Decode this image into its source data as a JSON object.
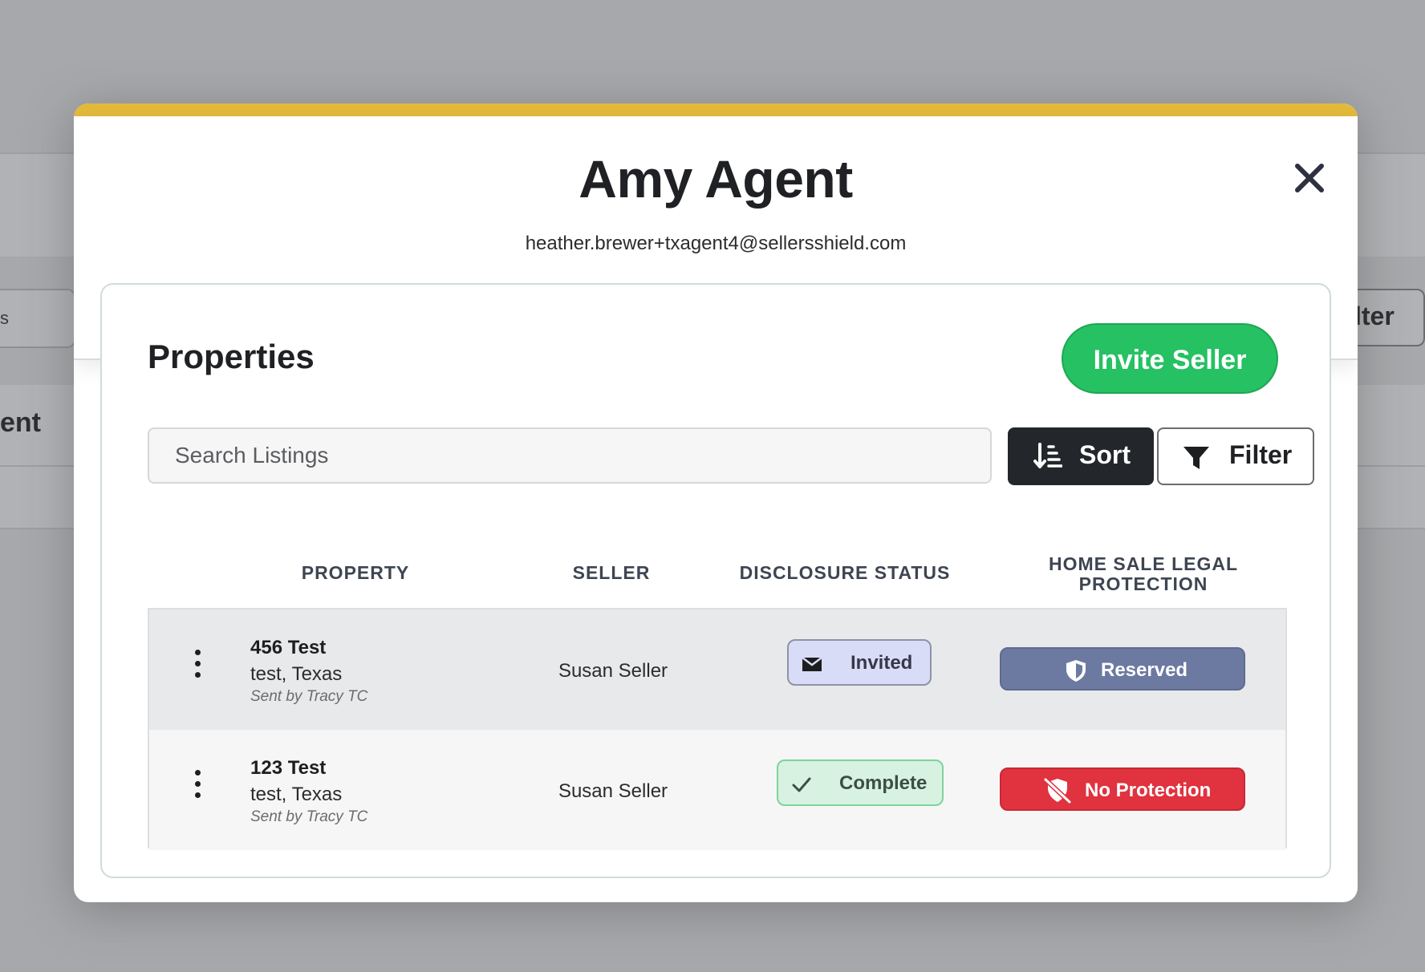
{
  "background": {
    "left_field_fragment": "s",
    "left_text_fragment": "ent",
    "right_button_fragment": "lter"
  },
  "modal": {
    "title": "Amy Agent",
    "email": "heather.brewer+txagent4@sellersshield.com",
    "accent_color": "#e2b93b"
  },
  "properties": {
    "heading": "Properties",
    "invite_button": "Invite Seller",
    "search_placeholder": "Search Listings",
    "sort_label": "Sort",
    "filter_label": "Filter"
  },
  "table": {
    "headers": {
      "property": "PROPERTY",
      "seller": "SELLER",
      "disclosure_status": "DISCLOSURE STATUS",
      "protection_line1": "HOME SALE LEGAL",
      "protection_line2": "PROTECTION"
    },
    "rows": [
      {
        "address": "456 Test",
        "city": "test, Texas",
        "sent_by": "Sent by Tracy TC",
        "seller": "Susan Seller",
        "disclosure_status": "Invited",
        "disclosure_icon": "envelope-icon",
        "protection": "Reserved",
        "protection_icon": "shield-icon",
        "protection_color": "#6c7aa2"
      },
      {
        "address": "123 Test",
        "city": "test, Texas",
        "sent_by": "Sent by Tracy TC",
        "seller": "Susan Seller",
        "disclosure_status": "Complete",
        "disclosure_icon": "check-icon",
        "protection": "No Protection",
        "protection_icon": "shield-slash-icon",
        "protection_color": "#e0323f"
      }
    ]
  },
  "colors": {
    "invite_green": "#25c162",
    "sort_dark": "#23262a"
  }
}
